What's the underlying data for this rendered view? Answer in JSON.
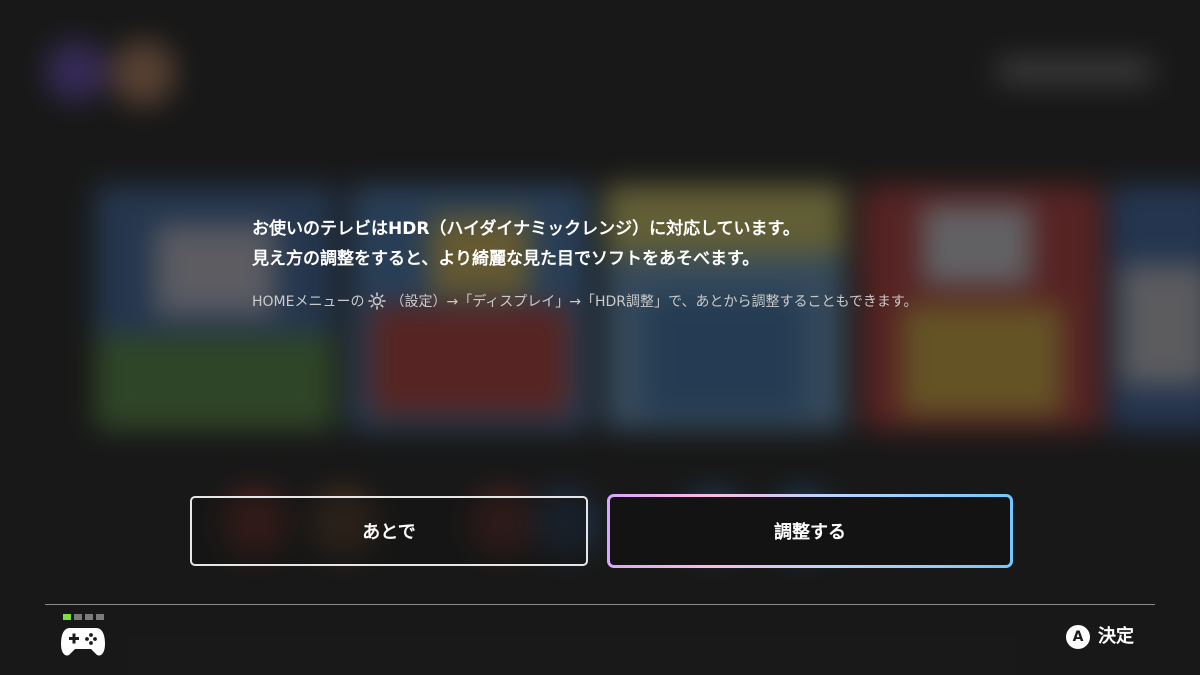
{
  "dialog": {
    "message_line1": "お使いのテレビはHDR（ハイダイナミックレンジ）に対応しています。",
    "message_line2": "見え方の調整をすると、より綺麗な見た目でソフトをあそべます。",
    "hint_before": "HOMEメニューの",
    "hint_after": "（設定）→「ディスプレイ」→「HDR調整」で、あとから調整することもできます。",
    "later_button": "あとで",
    "adjust_button": "調整する"
  },
  "footer": {
    "a_button_glyph": "A",
    "confirm_label": "決定",
    "player_indicator": "player 1 of 4",
    "active_player_color": "#7ee03a"
  },
  "icons": [
    "settings-gear-icon",
    "controller-icon",
    "a-button-icon"
  ],
  "colors": {
    "background": "#1b1b1b",
    "text": "#ffffff",
    "hint_text": "#c9c9c9",
    "selected_border_gradient": [
      "#d9a6ff",
      "#ffb8df",
      "#b9d4ff",
      "#6fc8ff"
    ]
  }
}
